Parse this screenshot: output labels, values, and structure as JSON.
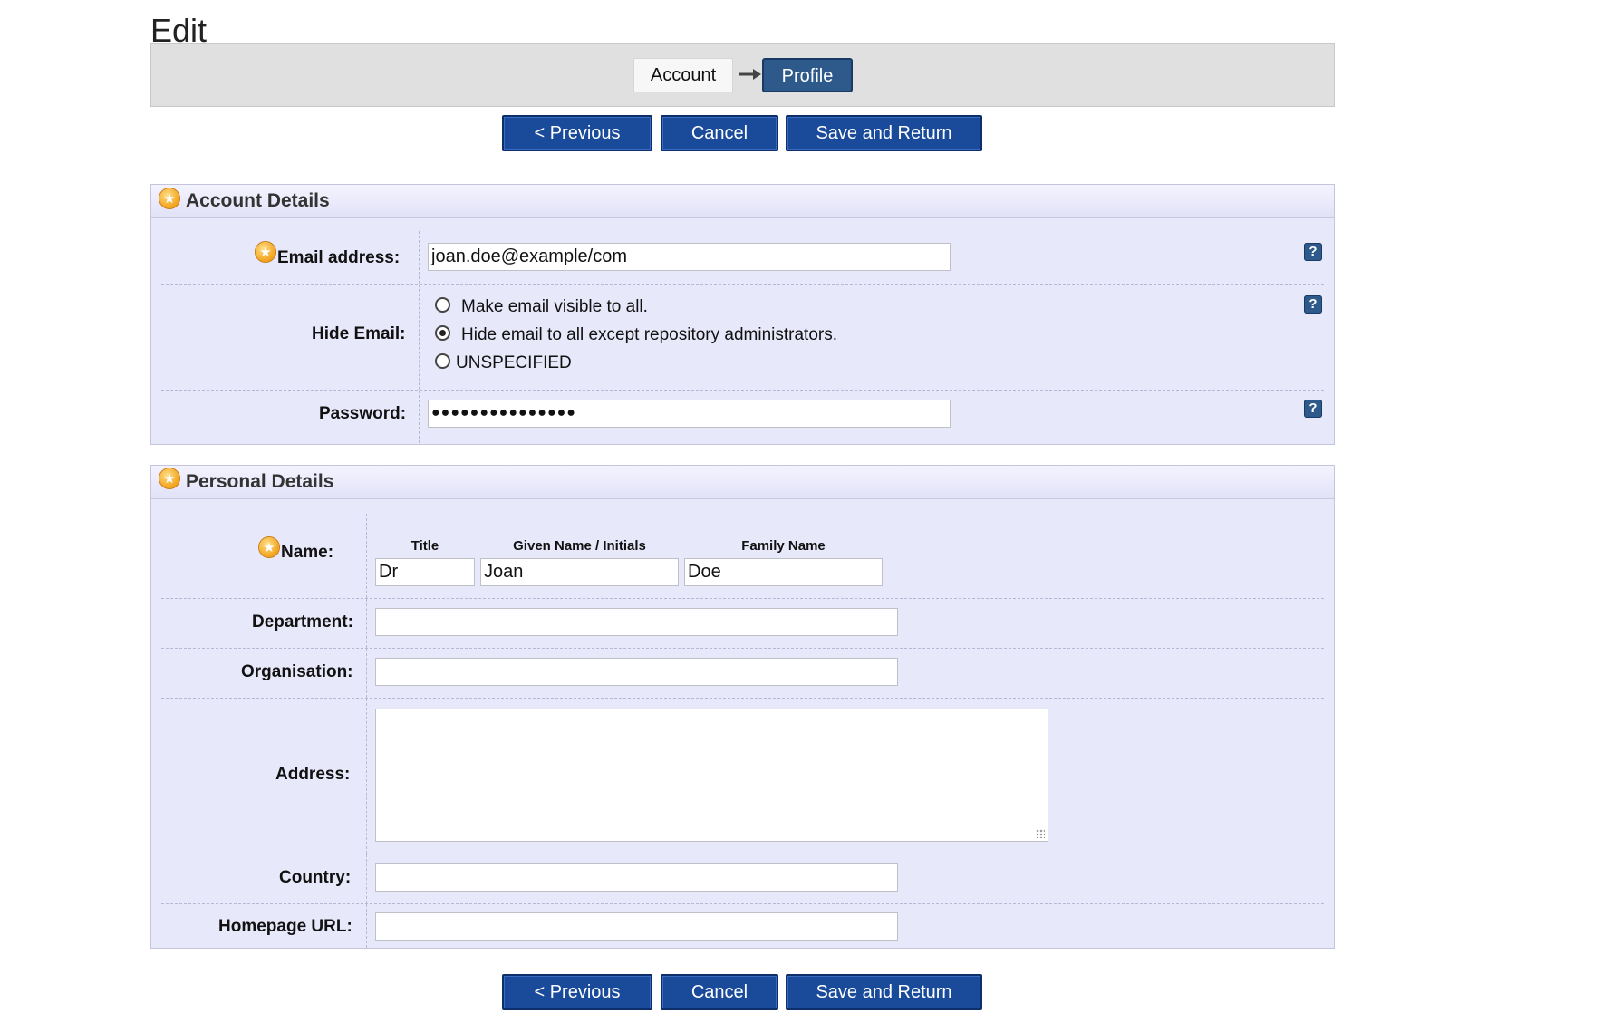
{
  "page": {
    "title": "Edit"
  },
  "wizard": {
    "stage_account": "Account",
    "stage_profile": "Profile"
  },
  "buttons": {
    "previous": "< Previous",
    "cancel": "Cancel",
    "save": "Save and Return"
  },
  "account_details": {
    "heading": "Account Details",
    "email_label": "Email address:",
    "email_value": "joan.doe@example/com",
    "hide_email_label": "Hide Email:",
    "hide_email_options": [
      {
        "label": "Make email visible to all.",
        "checked": false
      },
      {
        "label": "Hide email to all except repository administrators.",
        "checked": true
      },
      {
        "label": "UNSPECIFIED",
        "checked": false
      }
    ],
    "password_label": "Password:",
    "password_value": "●●●●●●●●●●●●●●●",
    "help_icon": "?"
  },
  "personal_details": {
    "heading": "Personal Details",
    "name_label": "Name:",
    "name_columns": {
      "title": "Title",
      "given": "Given Name / Initials",
      "family": "Family Name"
    },
    "name_values": {
      "title": "Dr",
      "given": "Joan",
      "family": "Doe"
    },
    "department_label": "Department:",
    "department_value": "",
    "organisation_label": "Organisation:",
    "organisation_value": "",
    "address_label": "Address:",
    "address_value": "",
    "country_label": "Country:",
    "country_value": "",
    "homepage_label": "Homepage URL:",
    "homepage_value": ""
  },
  "colors": {
    "button": "#1a4a9a",
    "panel": "#e8e8fb",
    "required_star": "#f2a21a"
  }
}
